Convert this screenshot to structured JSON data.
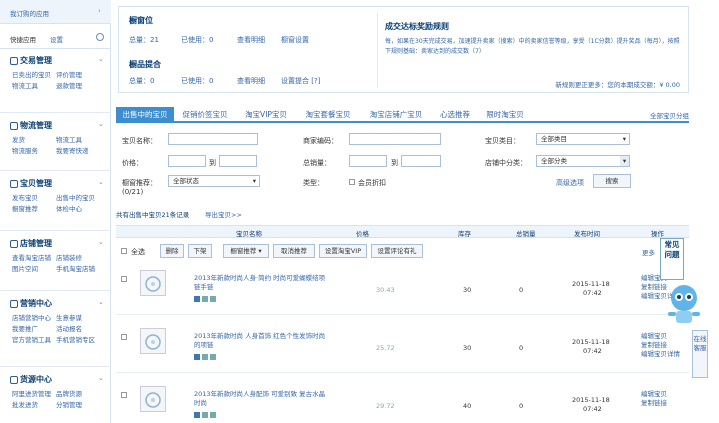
{
  "sidebar": {
    "top1": "我订购的应用",
    "top2": "快捷应用",
    "top2_badge": "设置",
    "sections": [
      {
        "title": "交易管理",
        "links": [
          [
            "已卖出的宝贝",
            "评价管理"
          ],
          [
            "物流工具",
            "退款管理"
          ]
        ]
      },
      {
        "title": "物流管理",
        "links": [
          [
            "发货",
            "物流工具"
          ],
          [
            "物流服务",
            "我要寄快递"
          ]
        ]
      },
      {
        "title": "宝贝管理",
        "links": [
          [
            "发布宝贝",
            "出售中的宝贝"
          ],
          [
            "橱窗推荐",
            "体检中心"
          ]
        ]
      },
      {
        "title": "店铺管理",
        "links": [
          [
            "查看淘宝店铺",
            "店铺装修"
          ],
          [
            "图片空间",
            "手机淘宝店铺"
          ]
        ]
      },
      {
        "title": "营销中心",
        "links": [
          [
            "店铺营销中心",
            "生意参谋"
          ],
          [
            "我要推广",
            "活动报名"
          ],
          [
            "官方营销工具",
            "手机营销专区"
          ]
        ]
      },
      {
        "title": "货源中心",
        "links": [
          [
            "阿里进货管理",
            "品牌货源"
          ],
          [
            "批发进货",
            "分销管理"
          ]
        ]
      }
    ]
  },
  "panel": {
    "left_title1": "橱窗位",
    "left_row1": [
      "总量：21",
      "已使用：0",
      "查看明细",
      "橱窗设置"
    ],
    "left_title2": "橱品提合",
    "left_row2": [
      "总量：0",
      "已使用：0",
      "查看明细",
      "设置提合 [?]"
    ],
    "right_title": "成交达标奖励规则",
    "right_text": "每，如果在30天完成交易，加速提升卖家（搜索）中的卖家信誉等级，享受（1C分数）提升奖品（每月），按照下规则基础：卖家达到的成交数（7）",
    "right_link": "新规则更正更多：您的本期成交额：¥ 0.00"
  },
  "tabs": [
    "出售中的宝贝",
    "促销价签宝贝",
    "淘宝VIP宝贝",
    "淘宝套餐宝贝",
    "淘宝店铺广宝贝",
    "心选推荐",
    "限时淘宝贝"
  ],
  "tab_right": "全部宝贝分组",
  "filters": {
    "name": "宝贝名称：",
    "code": "商家编码：",
    "cat": "宝贝类目：",
    "cat_val": "全部类目",
    "price": "价格：",
    "to": "到",
    "sales": "总销量：",
    "shop_cat": "店铺中分类：",
    "shop_val": "全部分类",
    "status": "橱窗推荐：",
    "status_val": "全部状态",
    "count": "(0/21)",
    "type": "类型：",
    "vip": "会员折扣",
    "more": "高级选项",
    "search": "搜索"
  },
  "summary": "共有出售中宝贝21条记录",
  "summary_link": "导出宝贝>>",
  "headers": [
    "宝贝名称",
    "价格",
    "库存",
    "总销量",
    "发布时间",
    "操作"
  ],
  "toolbar": [
    "全选",
    "删除",
    "下架",
    "橱窗推荐",
    "取消推荐",
    "设置淘宝VIP",
    "设置评论有礼"
  ],
  "toolbar_more": "更多",
  "items": [
    {
      "title": "2013年新款时尚人身·简约 时尚可爱蝴蝶结项链手链",
      "price": "30.43",
      "stock": "30",
      "sales": "0",
      "date": "2015-11-18",
      "time": "07:42",
      "ops": [
        "编辑宝贝",
        "复制链接",
        "编辑宝贝详情"
      ]
    },
    {
      "title": "2013年新款时尚 人身首饰 红色个性发饰时尚的项链",
      "price": "25.72",
      "stock": "30",
      "sales": "0",
      "date": "2015-11-18",
      "time": "07:42",
      "ops": [
        "编辑宝贝",
        "复制链接",
        "编辑宝贝详情"
      ]
    },
    {
      "title": "2013年新款时尚人身配饰 可爱别致 复古水晶 时尚",
      "price": "29.72",
      "stock": "40",
      "sales": "0",
      "date": "2015-11-18",
      "time": "07:42",
      "ops": [
        "编辑宝贝",
        "复制链接"
      ]
    }
  ],
  "widget": {
    "text": "常见问题"
  },
  "side_tab": "在线客服"
}
